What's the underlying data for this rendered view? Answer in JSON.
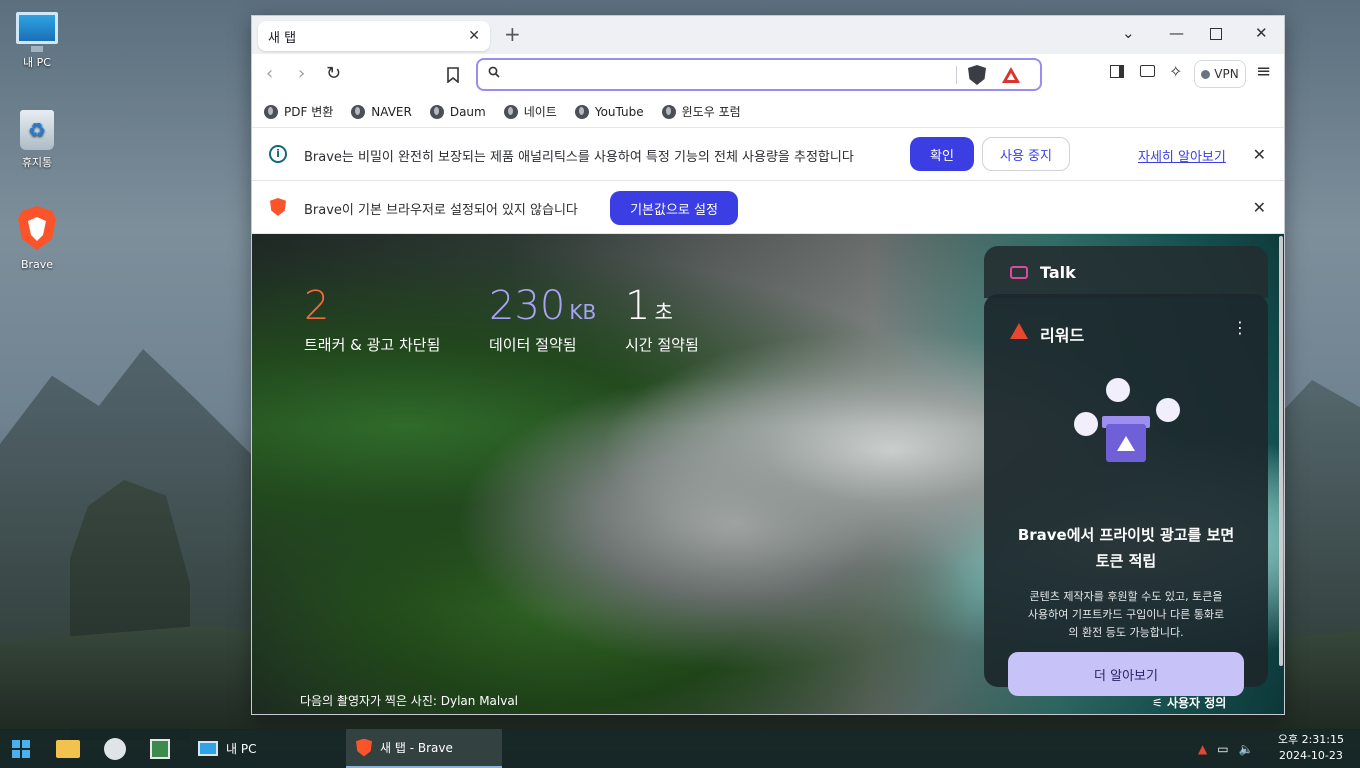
{
  "desktop": {
    "icons": [
      {
        "label": "내 PC"
      },
      {
        "label": "휴지통"
      },
      {
        "label": "Brave"
      }
    ]
  },
  "browser": {
    "tab_title": "새 탭",
    "url_placeholder": "",
    "vpn_label": "VPN",
    "bookmarks": [
      "PDF 변환",
      "NAVER",
      "Daum",
      "네이트",
      "YouTube",
      "윈도우 포럼"
    ],
    "analytics_bar": {
      "message": "Brave는 비밀이 완전히 보장되는 제품 애널리틱스를 사용하여 특정 기능의 전체 사용량을 추정합니다",
      "confirm": "확인",
      "stop": "사용 중지",
      "learn_more": "자세히 알아보기"
    },
    "default_bar": {
      "message": "Brave이 기본 브라우저로 설정되어 있지 않습니다",
      "set_default": "기본값으로 설정"
    }
  },
  "new_tab": {
    "stats": [
      {
        "value": "2",
        "unit": "",
        "label": "트래커 & 광고 차단됨",
        "color": "#f2683c"
      },
      {
        "value": "230",
        "unit": "KB",
        "label": "데이터 절약됨",
        "color": "#a9a3f5"
      },
      {
        "value": "1",
        "unit": "초",
        "label": "시간 절약됨",
        "color": "#ffffff"
      }
    ],
    "talk_label": "Talk",
    "rewards": {
      "header": "리워드",
      "title_line1": "Brave에서 프라이빗 광고를 보면",
      "title_line2": "토큰 적립",
      "desc_line1": "콘텐츠 제작자를 후원할 수도 있고, 토큰을",
      "desc_line2": "사용하여 기프트카드 구입이나 다른 통화로",
      "desc_line3": "의 환전 등도 가능합니다.",
      "learn_button": "더 알아보기"
    },
    "photo_credit": "다음의 촬영자가 찍은 사진: Dylan Malval",
    "customize": "사용자 정의"
  },
  "taskbar": {
    "my_pc": "내 PC",
    "brave_window": "새 탭 - Brave",
    "time": "오후 2:31:15",
    "date": "2024-10-23"
  }
}
